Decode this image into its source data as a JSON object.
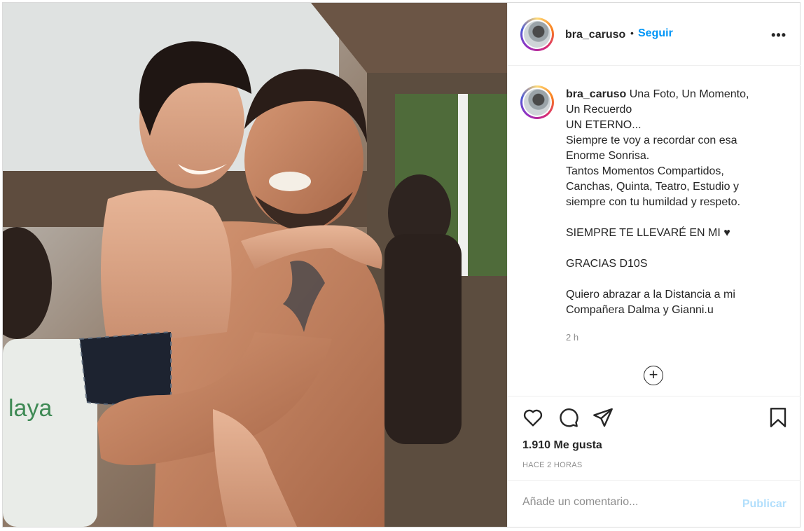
{
  "post": {
    "photo_icon": "post-photo",
    "header": {
      "username": "bra_caruso",
      "separator": "•",
      "follow_label": "Seguir",
      "more_icon": "more-horizontal-icon",
      "more_label": "•••"
    },
    "caption": {
      "username": "bra_caruso",
      "lines": [
        "Una Foto, Un Momento,",
        "Un Recuerdo",
        "UN ETERNO...",
        "Siempre te voy a recordar con esa",
        "Enorme Sonrisa.",
        "Tantos Momentos Compartidos,",
        "Canchas, Quinta, Teatro, Estudio y",
        "siempre con tu humildad y respeto.",
        "",
        "SIEMPRE TE LLEVARÉ EN MI ♥",
        "",
        "GRACIAS D10S",
        "",
        "Quiero abrazar a la Distancia a mi",
        "Compañera Dalma y Gianni.u"
      ],
      "time": "2 h",
      "load_more_icon": "plus-circle-icon",
      "load_more_label": "+"
    },
    "actions": {
      "like_icon": "heart-icon",
      "comment_icon": "comment-icon",
      "share_icon": "paper-plane-icon",
      "save_icon": "bookmark-icon"
    },
    "likes": "1.910 Me gusta",
    "posted_ago": "HACE 2 HORAS",
    "comment": {
      "placeholder": "Añade un comentario...",
      "value": "",
      "publish_label": "Publicar"
    },
    "colors": {
      "link_blue": "#0095f6",
      "publish_disabled": "#b2dffc",
      "secondary_text": "#8e8e8e",
      "border": "#dbdbdb"
    }
  }
}
